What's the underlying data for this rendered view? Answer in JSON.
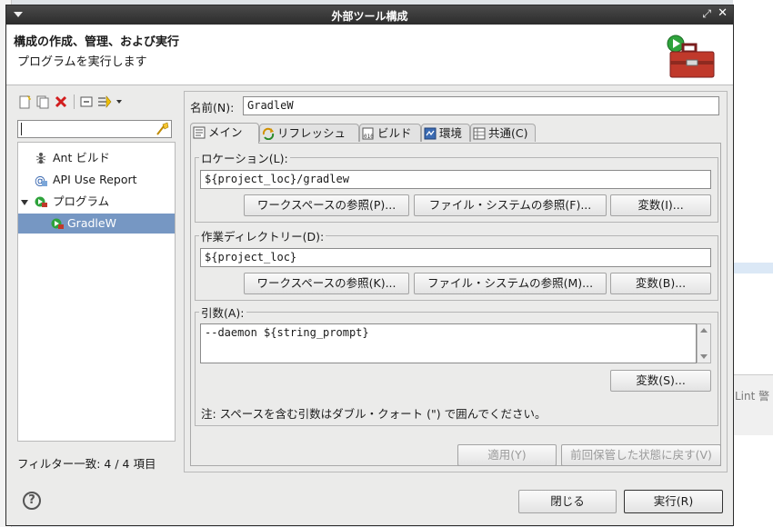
{
  "dialog": {
    "title": "外部ツール構成",
    "header_title": "構成の作成、管理、および実行",
    "header_subtitle": "プログラムを実行します"
  },
  "background": {
    "lint_text": "Lint 警"
  },
  "left": {
    "toolbar_icons": [
      "new-config-icon",
      "duplicate-icon",
      "delete-icon",
      "collapse-all-icon",
      "filter-icon",
      "dropdown-icon"
    ],
    "search_value": "",
    "tree": [
      {
        "label": "Ant ビルド",
        "icon": "ant-icon",
        "level": 1
      },
      {
        "label": "API Use Report",
        "icon": "api-report-icon",
        "level": 1
      },
      {
        "label": "プログラム",
        "icon": "program-icon",
        "level": 0,
        "expanded": true
      },
      {
        "label": "GradleW",
        "icon": "program-config-icon",
        "level": 2,
        "selected": true
      }
    ],
    "filter_label": "フィルター一致: 4 / 4 項目"
  },
  "right": {
    "name_label": "名前(N):",
    "name_value": "GradleW",
    "tabs": [
      {
        "label": "メイン",
        "icon": "main-tab-icon",
        "active": true
      },
      {
        "label": "リフレッシュ",
        "icon": "refresh-icon"
      },
      {
        "label": "ビルド",
        "icon": "build-icon"
      },
      {
        "label": "環境",
        "icon": "environment-icon"
      },
      {
        "label": "共通(C)",
        "icon": "common-icon"
      }
    ],
    "location": {
      "label": "ロケーション(L):",
      "value": "${project_loc}/gradlew",
      "btn_workspace": "ワークスペースの参照(P)...",
      "btn_filesystem": "ファイル・システムの参照(F)...",
      "btn_variables": "変数(I)..."
    },
    "workdir": {
      "label": "作業ディレクトリー(D):",
      "value": "${project_loc}",
      "btn_workspace": "ワークスペースの参照(K)...",
      "btn_filesystem": "ファイル・システムの参照(M)...",
      "btn_variables": "変数(B)..."
    },
    "args": {
      "label": "引数(A):",
      "value": "--daemon ${string_prompt}",
      "btn_variables": "変数(S)...",
      "note": "注: スペースを含む引数はダブル・クォート (\") で囲んでください。"
    },
    "apply": "適用(Y)",
    "revert": "前回保管した状態に戻す(V)"
  },
  "footer": {
    "close": "閉じる",
    "run": "実行(R)",
    "help_glyph": "?"
  }
}
